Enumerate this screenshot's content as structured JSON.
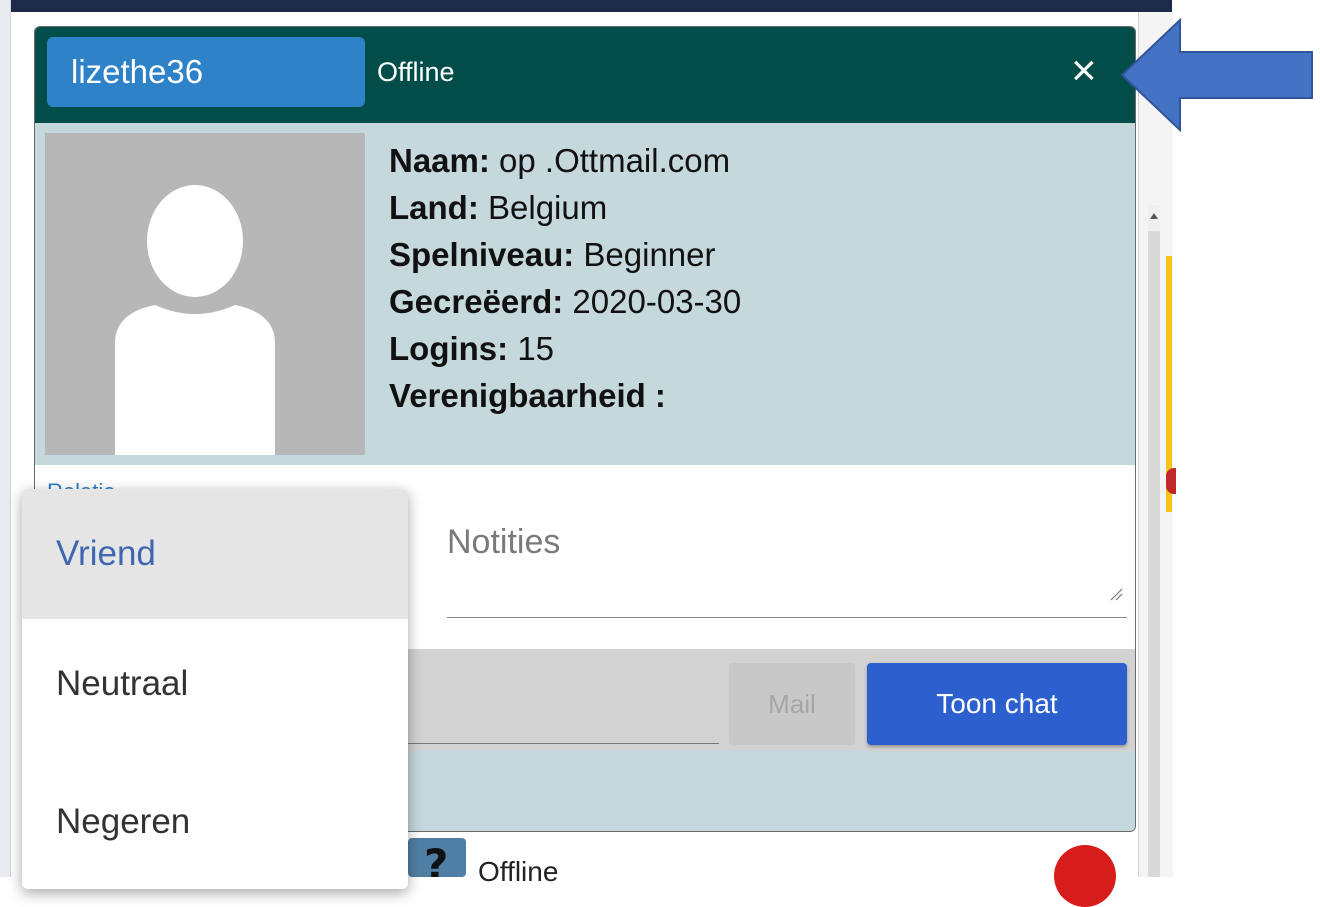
{
  "colors": {
    "header_bg": "#004d49",
    "username_bg": "#2e83c8",
    "profile_bg": "#c5d8dc",
    "primary_button": "#2d5fcf",
    "arrow": "#4472c4"
  },
  "dialog": {
    "username": "lizethe36",
    "status": "Offline",
    "close_icon": "×",
    "profile": {
      "name_label": "Naam:",
      "name_value": " op .Ottmail.com",
      "country_label": "Land:",
      "country_value": " Belgium",
      "level_label": "Spelniveau:",
      "level_value": " Beginner",
      "created_label": "Gecreëerd:",
      "created_value": " 2020-03-30",
      "logins_label": "Logins:",
      "logins_value": " 15",
      "association_label": "Verenigbaarheid :"
    },
    "relation_link": "Relatie",
    "notes_placeholder": "Notities",
    "mail_button": "Mail",
    "chat_button": "Toon chat"
  },
  "relation_dropdown": {
    "selected": "Vriend",
    "options": [
      "Vriend",
      "Neutraal",
      "Negeren"
    ]
  },
  "background_list": {
    "row_status": "Offline",
    "row_icon": "?"
  }
}
